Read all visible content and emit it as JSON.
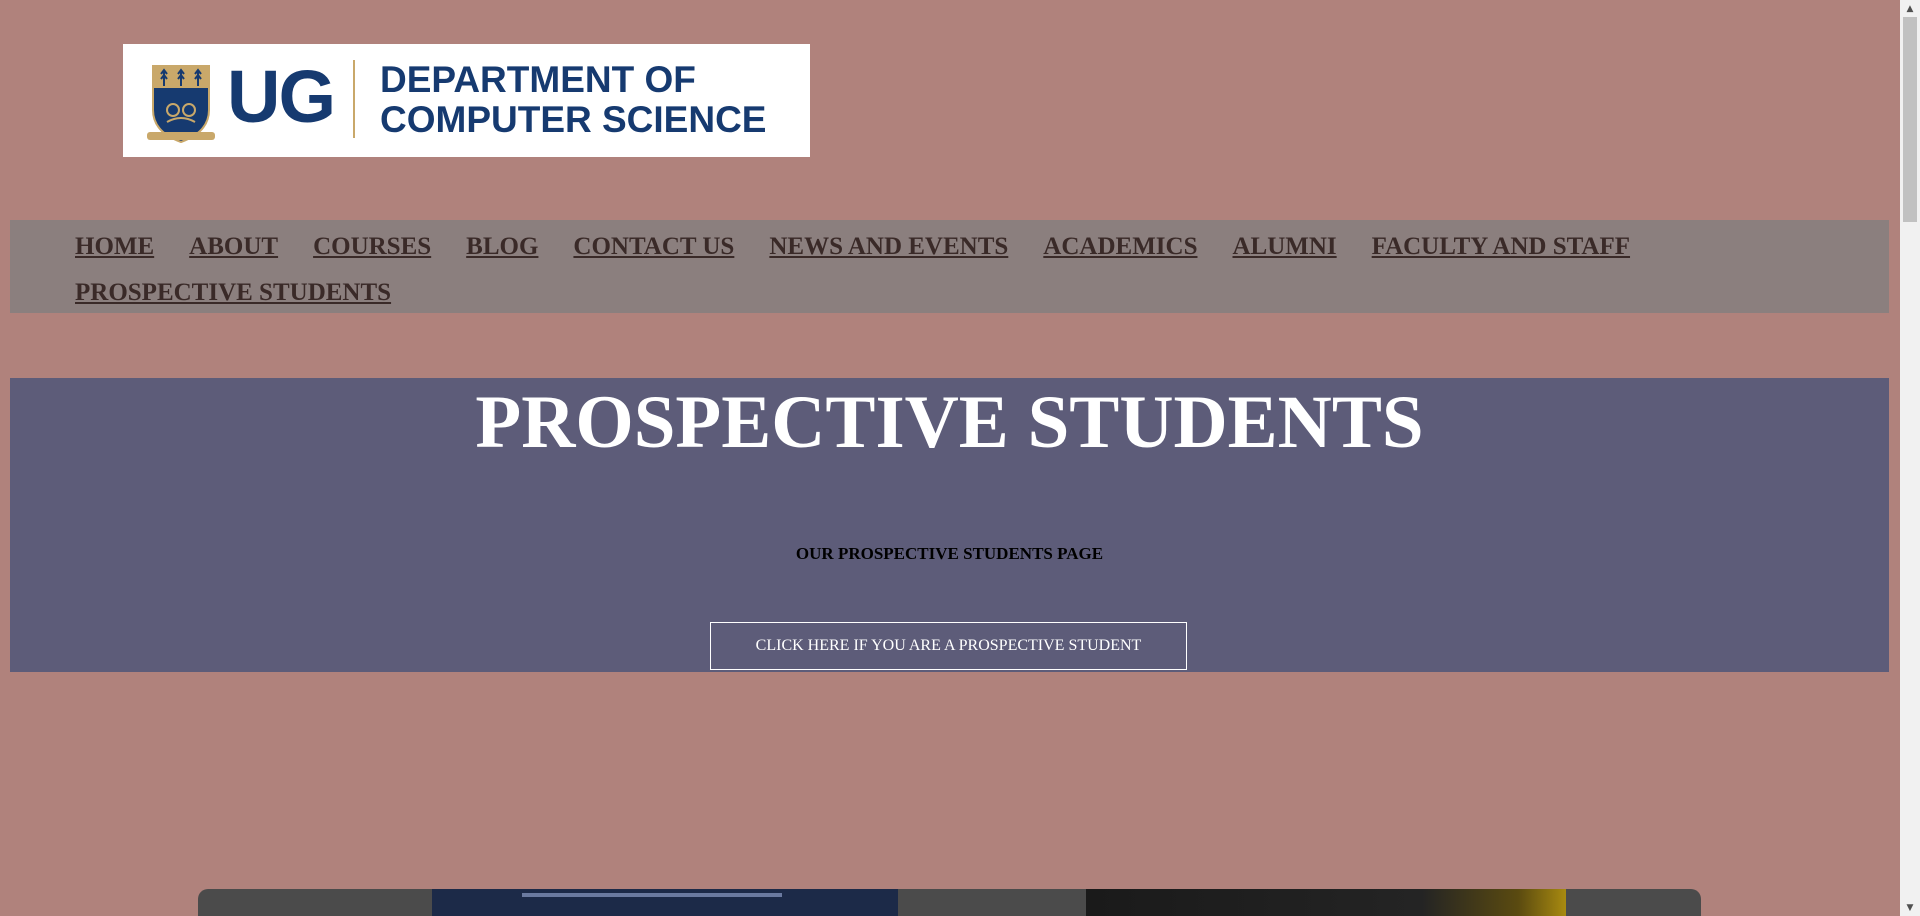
{
  "logo": {
    "ug_text": "UG",
    "department_text": "DEPARTMENT OF\nCOMPUTER SCIENCE",
    "colors": {
      "navy": "#163a70",
      "gold": "#c9a86a"
    }
  },
  "nav": {
    "items": [
      {
        "label": "HOME"
      },
      {
        "label": "ABOUT"
      },
      {
        "label": "COURSES"
      },
      {
        "label": "BLOG"
      },
      {
        "label": "CONTACT US"
      },
      {
        "label": "NEWS AND EVENTS"
      },
      {
        "label": "ACADEMICS"
      },
      {
        "label": "ALUMNI"
      },
      {
        "label": "FACULTY AND STAFF"
      },
      {
        "label": "PROSPECTIVE STUDENTS"
      }
    ]
  },
  "hero": {
    "title": "PROSPECTIVE STUDENTS",
    "subtitle": "OUR PROSPECTIVE STUDENTS PAGE",
    "button_label": "CLICK HERE IF YOU ARE A PROSPECTIVE STUDENT"
  },
  "theme": {
    "page_bg": "#b0827c",
    "nav_bg": "#8b7f7e",
    "hero_bg": "#5d5c79"
  },
  "scrollbar": {
    "up_icon": "triangle-up-icon",
    "down_icon": "triangle-down-icon"
  }
}
